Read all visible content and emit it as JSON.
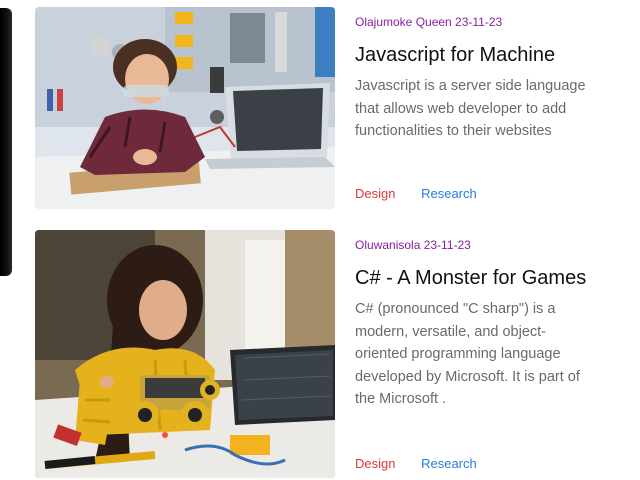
{
  "posts": [
    {
      "meta": "Olajumoke Queen 23-11-23",
      "title": "Javascript for Machine",
      "excerpt": "Javascript is a server side language that allows web developer to add functionalities to their websites",
      "tags": [
        "Design",
        "Research"
      ]
    },
    {
      "meta": "Oluwanisola 23-11-23",
      "title": "C# - A Monster for Games",
      "excerpt": "C# (pronounced \"C sharp\") is a modern, versatile, and object-oriented programming language developed by Microsoft. It is part of the Microsoft .",
      "tags": [
        "Design",
        "Research"
      ]
    }
  ],
  "colors": {
    "meta": "#8b1fa0",
    "tag_design": "#d93a3a",
    "tag_research": "#2b7bd9"
  }
}
